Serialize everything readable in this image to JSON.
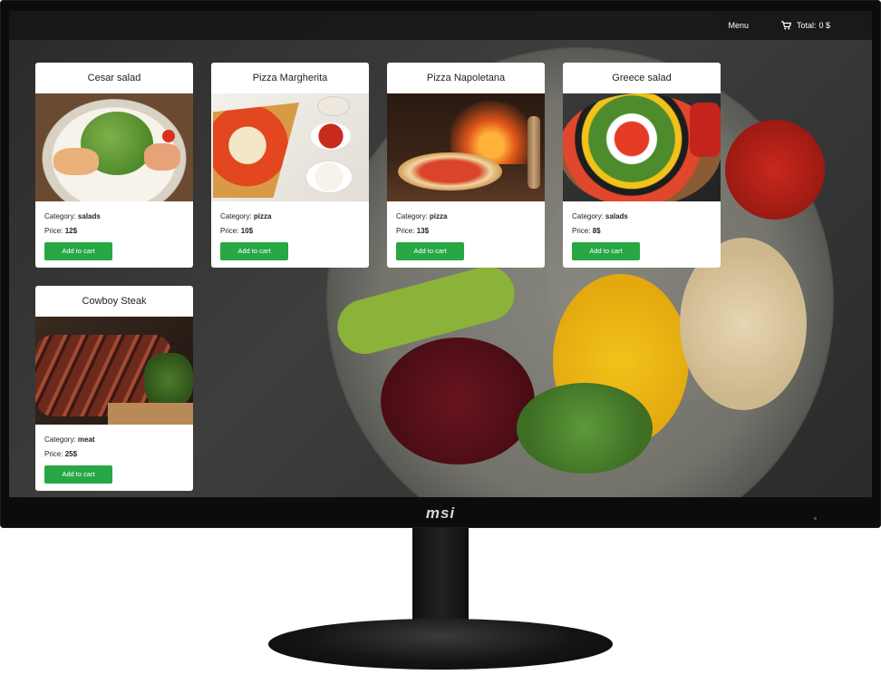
{
  "navbar": {
    "menu_label": "Menu",
    "total_label": "Total:",
    "total_value": "0 $",
    "cart_icon": "cart-icon"
  },
  "products": [
    {
      "title": "Cesar salad",
      "category_label": "Category:",
      "category": "salads",
      "price_label": "Price:",
      "price": "12$",
      "button": "Add to cart",
      "image": "caesar-salad-photo"
    },
    {
      "title": "Pizza Margherita",
      "category_label": "Category:",
      "category": "pizza",
      "price_label": "Price:",
      "price": "10$",
      "button": "Add to cart",
      "image": "pizza-margherita-photo"
    },
    {
      "title": "Pizza Napoletana",
      "category_label": "Category:",
      "category": "pizza",
      "price_label": "Price:",
      "price": "13$",
      "button": "Add to cart",
      "image": "pizza-napoletana-photo"
    },
    {
      "title": "Greece salad",
      "category_label": "Category:",
      "category": "salads",
      "price_label": "Price:",
      "price": "8$",
      "button": "Add to cart",
      "image": "greek-salad-photo"
    },
    {
      "title": "Cowboy Steak",
      "category_label": "Category:",
      "category": "meat",
      "price_label": "Price:",
      "price": "25$",
      "button": "Add to cart",
      "image": "cowboy-steak-photo"
    }
  ],
  "monitor": {
    "brand": "msi"
  },
  "colors": {
    "button": "#28a745",
    "navbar": "#141414"
  }
}
